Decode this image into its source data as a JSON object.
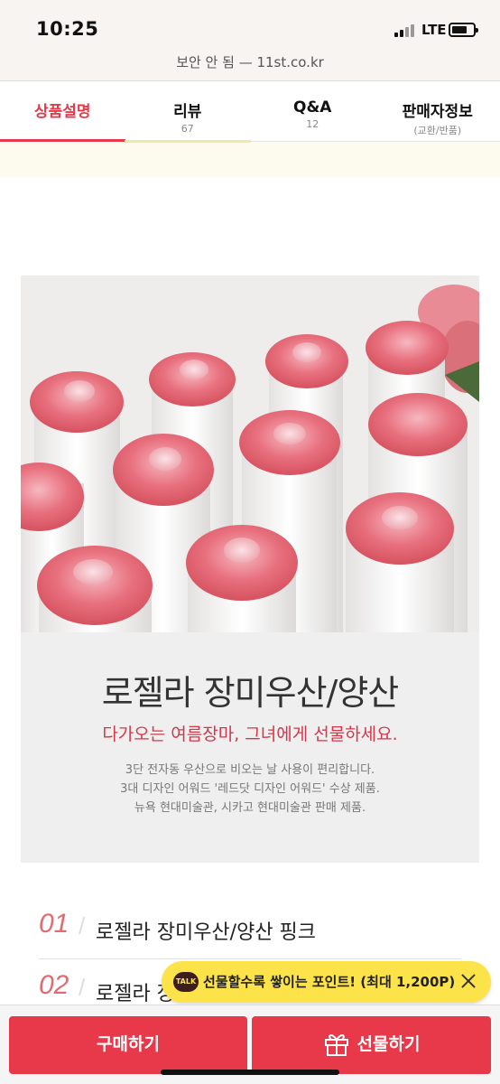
{
  "status": {
    "time": "10:25",
    "network": "LTE"
  },
  "browser": {
    "url_text": "보안 안 됨 — 11st.co.kr"
  },
  "tabs": [
    {
      "label": "상품설명",
      "sub": "",
      "active": true
    },
    {
      "label": "리뷰",
      "sub": "67",
      "active": false
    },
    {
      "label": "Q&A",
      "sub": "12",
      "active": false
    },
    {
      "label": "판매자정보",
      "sub": "(교환/반품)",
      "active": false
    }
  ],
  "product": {
    "title": "로젤라 장미우산/양산",
    "subtitle": "다가오는 여름장마, 그녀에게 선물하세요.",
    "description": [
      "3단 전자동 우산으로 비오는 날 사용이 편리합니다.",
      "3대 디자인 어워드 '레드닷 디자인 어워드' 수상 제품.",
      "뉴욕 현대미술관, 시카고 현대미술관 판매 제품."
    ]
  },
  "options": [
    {
      "num": "01",
      "name": "로젤라 장미우산/양산 핑크"
    },
    {
      "num": "02",
      "name": "로젤라 장"
    }
  ],
  "point_banner": {
    "badge": "TALK",
    "text": "선물할수록 쌓이는 포인트! (최대 1,200P)"
  },
  "actions": {
    "buy": "구매하기",
    "gift": "선물하기"
  },
  "colors": {
    "accent": "#e8394a",
    "banner": "#fde34a"
  }
}
